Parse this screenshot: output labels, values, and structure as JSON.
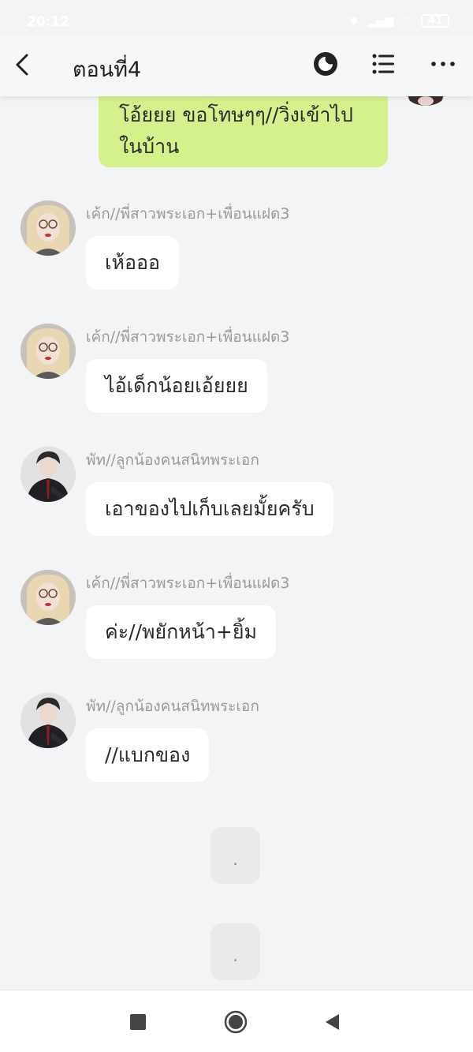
{
  "status": {
    "time": "20:12",
    "battery": "41"
  },
  "header": {
    "title": "ตอนที่4"
  },
  "my_message": {
    "text_line1": "โอ้ยยย ขอโทษๆๆ//วิ่งเข้าไป",
    "text_line2": "ในบ้าน"
  },
  "messages": [
    {
      "sender": "เค้ก//พี่สาวพระเอก+เพื่อนแฝด3",
      "text": "เห้อออ",
      "avatar": "girl-avatar"
    },
    {
      "sender": "เค้ก//พี่สาวพระเอก+เพื่อนแฝด3",
      "text": "ไอ้เด็กน้อยเอ้ยยย",
      "avatar": "girl-avatar"
    },
    {
      "sender": "พัท//ลูกน้องคนสนิทพระเอก",
      "text": "เอาของไปเก็บเลยมั้ยครับ",
      "avatar": "man-avatar"
    },
    {
      "sender": "เค้ก//พี่สาวพระเอก+เพื่อนแฝด3",
      "text": "ค่ะ//พยักหน้า+ยิ้ม",
      "avatar": "girl-avatar"
    },
    {
      "sender": "พัท//ลูกน้องคนสนิทพระเอก",
      "text": "//แบกของ",
      "avatar": "man-avatar"
    }
  ],
  "narration": [
    {
      "text": "."
    },
    {
      "text": "."
    }
  ],
  "colors": {
    "my_bubble": "#d4f18b",
    "other_bubble": "#ffffff",
    "background": "#f3f4f6"
  }
}
